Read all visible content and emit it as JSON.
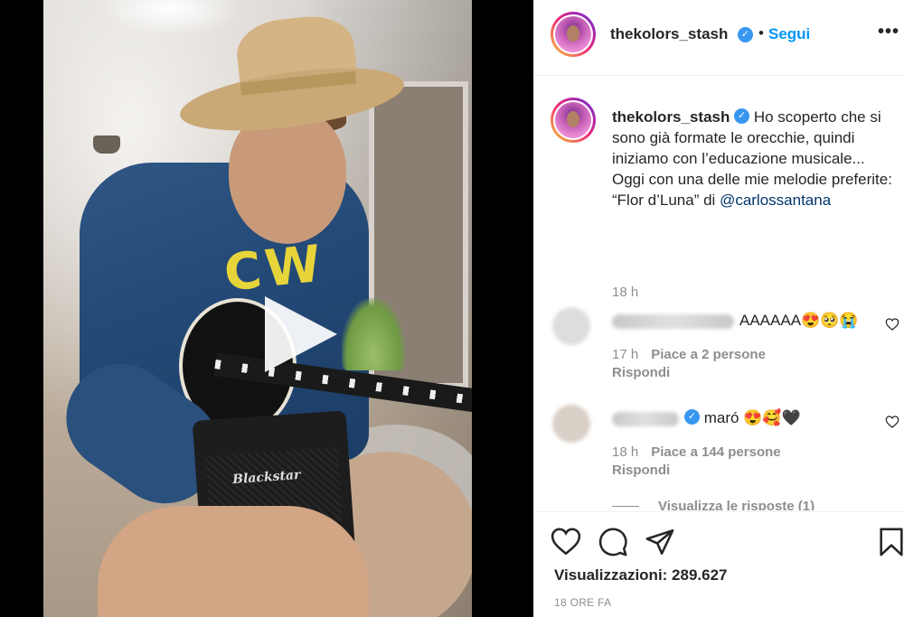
{
  "post": {
    "username": "thekolors_stash",
    "verified_symbol": "✓",
    "separator": "•",
    "follow_label": "Segui",
    "more_label": "•••"
  },
  "media": {
    "amp_brand": "Blackstar",
    "shirt_print": "CW",
    "play_icon": "play-icon"
  },
  "caption": {
    "username": "thekolors_stash",
    "text_line1": " Ho scoperto che si sono già formate le orecchie, quindi iniziamo con l’educazione musicale...",
    "text_line2": "Oggi con una delle mie melodie preferite: “Flor d’Luna” di ",
    "mention": "@carlossantana",
    "time": "18 h"
  },
  "comments": [
    {
      "text": "AAAAAA😍🥺😭",
      "time": "17 h",
      "likes": "Piace a 2 persone",
      "reply": "Rispondi"
    },
    {
      "text": "maró 😍🥰🖤",
      "time": "18 h",
      "likes": "Piace a 144 persone",
      "reply": "Rispondi",
      "view_replies": "Visualizza le risposte (1)"
    }
  ],
  "actions": {
    "views_label": "Visualizzazioni: 289.627",
    "time_ago": "18 ORE FA"
  },
  "colors": {
    "accent": "#0095f6",
    "verified": "#3897f0",
    "text_primary": "#262626",
    "text_secondary": "#8e8e8e",
    "mention": "#00376b"
  }
}
